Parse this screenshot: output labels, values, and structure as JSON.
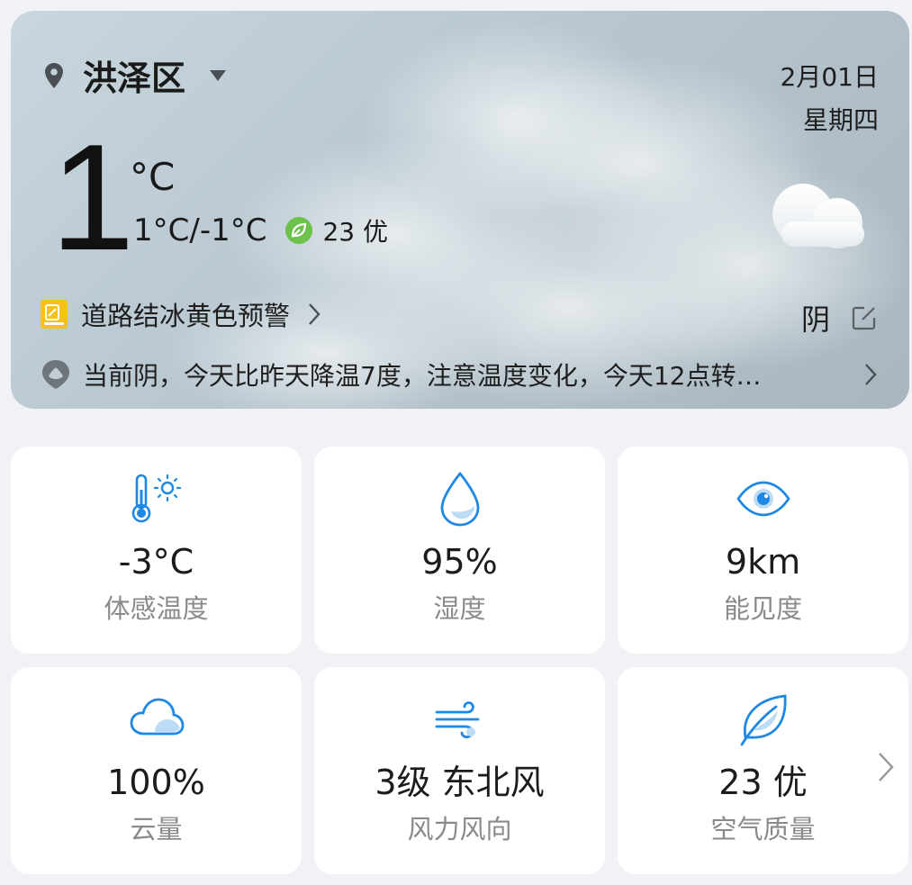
{
  "location": {
    "name": "洪泽区"
  },
  "date": {
    "day": "2月01日",
    "weekday": "星期四"
  },
  "current": {
    "temp": "1",
    "unit": "°C",
    "range": "1°C/-1°C",
    "aqi": "23 优",
    "condition": "阴"
  },
  "alert": {
    "text": "道路结冰黄色预警"
  },
  "summary": {
    "text": "当前阴，今天比昨天降温7度，注意温度变化，今天12点转…"
  },
  "tiles": [
    {
      "value": "-3°C",
      "label": "体感温度",
      "icon": "thermometer-sun-icon"
    },
    {
      "value": "95%",
      "label": "湿度",
      "icon": "water-drop-icon"
    },
    {
      "value": "9km",
      "label": "能见度",
      "icon": "eye-icon"
    },
    {
      "value": "100%",
      "label": "云量",
      "icon": "cloud-icon"
    },
    {
      "value": "3级 东北风",
      "label": "风力风向",
      "icon": "wind-icon"
    },
    {
      "value": "23 优",
      "label": "空气质量",
      "icon": "leaf-icon"
    }
  ],
  "colors": {
    "accent": "#1e88e5",
    "aqi_green": "#6cc24a",
    "alert_yellow": "#f4c21b"
  }
}
